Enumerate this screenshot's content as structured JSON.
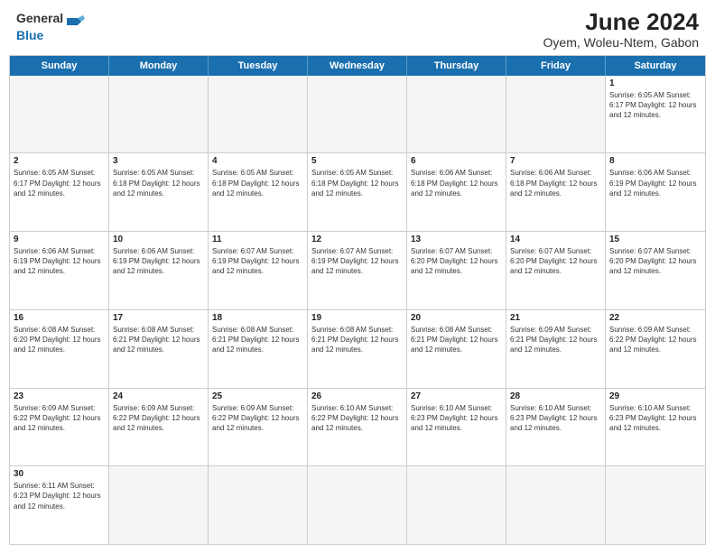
{
  "header": {
    "logo_general": "General",
    "logo_blue": "Blue",
    "title": "June 2024",
    "subtitle": "Oyem, Woleu-Ntem, Gabon"
  },
  "days_of_week": [
    "Sunday",
    "Monday",
    "Tuesday",
    "Wednesday",
    "Thursday",
    "Friday",
    "Saturday"
  ],
  "weeks": [
    [
      {
        "day": "",
        "info": ""
      },
      {
        "day": "",
        "info": ""
      },
      {
        "day": "",
        "info": ""
      },
      {
        "day": "",
        "info": ""
      },
      {
        "day": "",
        "info": ""
      },
      {
        "day": "",
        "info": ""
      },
      {
        "day": "1",
        "info": "Sunrise: 6:05 AM\nSunset: 6:17 PM\nDaylight: 12 hours and 12 minutes."
      }
    ],
    [
      {
        "day": "2",
        "info": "Sunrise: 6:05 AM\nSunset: 6:17 PM\nDaylight: 12 hours and 12 minutes."
      },
      {
        "day": "3",
        "info": "Sunrise: 6:05 AM\nSunset: 6:18 PM\nDaylight: 12 hours and 12 minutes."
      },
      {
        "day": "4",
        "info": "Sunrise: 6:05 AM\nSunset: 6:18 PM\nDaylight: 12 hours and 12 minutes."
      },
      {
        "day": "5",
        "info": "Sunrise: 6:05 AM\nSunset: 6:18 PM\nDaylight: 12 hours and 12 minutes."
      },
      {
        "day": "6",
        "info": "Sunrise: 6:06 AM\nSunset: 6:18 PM\nDaylight: 12 hours and 12 minutes."
      },
      {
        "day": "7",
        "info": "Sunrise: 6:06 AM\nSunset: 6:18 PM\nDaylight: 12 hours and 12 minutes."
      },
      {
        "day": "8",
        "info": "Sunrise: 6:06 AM\nSunset: 6:19 PM\nDaylight: 12 hours and 12 minutes."
      }
    ],
    [
      {
        "day": "9",
        "info": "Sunrise: 6:06 AM\nSunset: 6:19 PM\nDaylight: 12 hours and 12 minutes."
      },
      {
        "day": "10",
        "info": "Sunrise: 6:06 AM\nSunset: 6:19 PM\nDaylight: 12 hours and 12 minutes."
      },
      {
        "day": "11",
        "info": "Sunrise: 6:07 AM\nSunset: 6:19 PM\nDaylight: 12 hours and 12 minutes."
      },
      {
        "day": "12",
        "info": "Sunrise: 6:07 AM\nSunset: 6:19 PM\nDaylight: 12 hours and 12 minutes."
      },
      {
        "day": "13",
        "info": "Sunrise: 6:07 AM\nSunset: 6:20 PM\nDaylight: 12 hours and 12 minutes."
      },
      {
        "day": "14",
        "info": "Sunrise: 6:07 AM\nSunset: 6:20 PM\nDaylight: 12 hours and 12 minutes."
      },
      {
        "day": "15",
        "info": "Sunrise: 6:07 AM\nSunset: 6:20 PM\nDaylight: 12 hours and 12 minutes."
      }
    ],
    [
      {
        "day": "16",
        "info": "Sunrise: 6:08 AM\nSunset: 6:20 PM\nDaylight: 12 hours and 12 minutes."
      },
      {
        "day": "17",
        "info": "Sunrise: 6:08 AM\nSunset: 6:21 PM\nDaylight: 12 hours and 12 minutes."
      },
      {
        "day": "18",
        "info": "Sunrise: 6:08 AM\nSunset: 6:21 PM\nDaylight: 12 hours and 12 minutes."
      },
      {
        "day": "19",
        "info": "Sunrise: 6:08 AM\nSunset: 6:21 PM\nDaylight: 12 hours and 12 minutes."
      },
      {
        "day": "20",
        "info": "Sunrise: 6:08 AM\nSunset: 6:21 PM\nDaylight: 12 hours and 12 minutes."
      },
      {
        "day": "21",
        "info": "Sunrise: 6:09 AM\nSunset: 6:21 PM\nDaylight: 12 hours and 12 minutes."
      },
      {
        "day": "22",
        "info": "Sunrise: 6:09 AM\nSunset: 6:22 PM\nDaylight: 12 hours and 12 minutes."
      }
    ],
    [
      {
        "day": "23",
        "info": "Sunrise: 6:09 AM\nSunset: 6:22 PM\nDaylight: 12 hours and 12 minutes."
      },
      {
        "day": "24",
        "info": "Sunrise: 6:09 AM\nSunset: 6:22 PM\nDaylight: 12 hours and 12 minutes."
      },
      {
        "day": "25",
        "info": "Sunrise: 6:09 AM\nSunset: 6:22 PM\nDaylight: 12 hours and 12 minutes."
      },
      {
        "day": "26",
        "info": "Sunrise: 6:10 AM\nSunset: 6:22 PM\nDaylight: 12 hours and 12 minutes."
      },
      {
        "day": "27",
        "info": "Sunrise: 6:10 AM\nSunset: 6:23 PM\nDaylight: 12 hours and 12 minutes."
      },
      {
        "day": "28",
        "info": "Sunrise: 6:10 AM\nSunset: 6:23 PM\nDaylight: 12 hours and 12 minutes."
      },
      {
        "day": "29",
        "info": "Sunrise: 6:10 AM\nSunset: 6:23 PM\nDaylight: 12 hours and 12 minutes."
      }
    ],
    [
      {
        "day": "30",
        "info": "Sunrise: 6:11 AM\nSunset: 6:23 PM\nDaylight: 12 hours and 12 minutes."
      },
      {
        "day": "",
        "info": ""
      },
      {
        "day": "",
        "info": ""
      },
      {
        "day": "",
        "info": ""
      },
      {
        "day": "",
        "info": ""
      },
      {
        "day": "",
        "info": ""
      },
      {
        "day": "",
        "info": ""
      }
    ]
  ]
}
